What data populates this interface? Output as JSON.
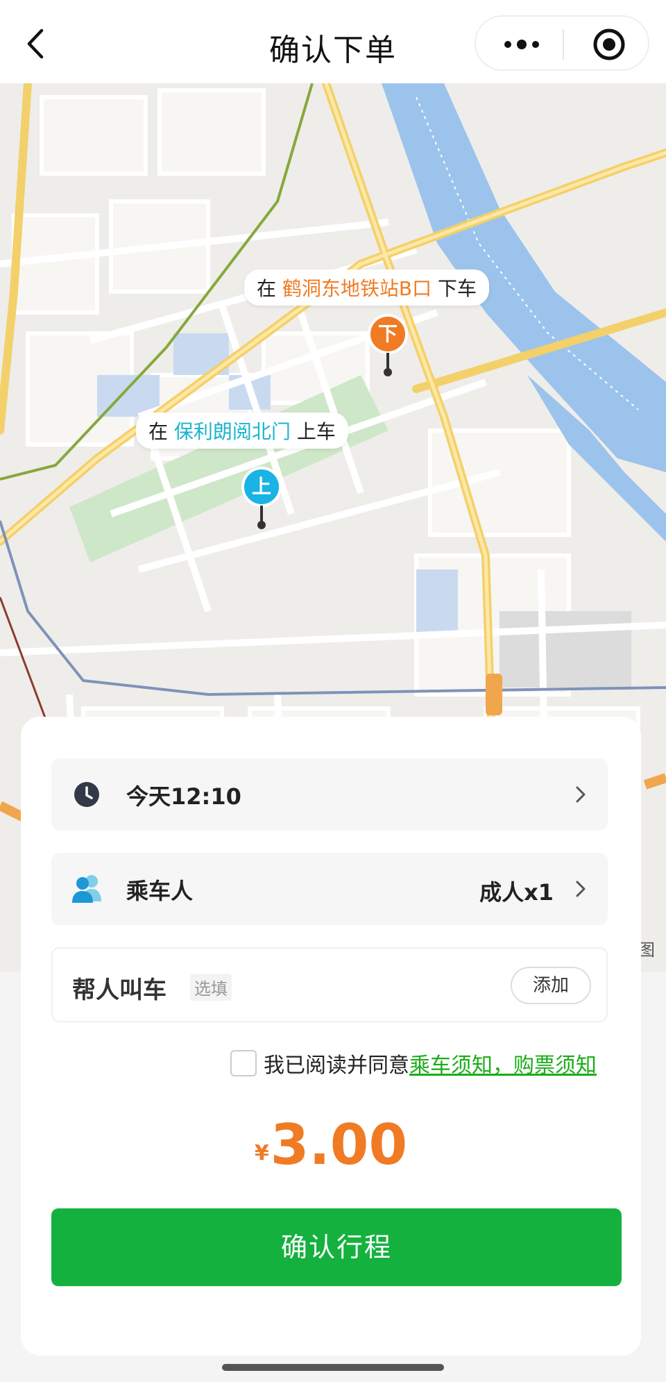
{
  "header": {
    "title": "确认下单",
    "back_icon": "chevron-left-icon",
    "more_icon": "more-dots-icon",
    "close_icon": "target-circle-icon"
  },
  "map": {
    "dropoff": {
      "prefix": "在 ",
      "place": "鹤洞东地铁站B口",
      "suffix": " 下车",
      "pin_text": "下",
      "color": "#f07b24"
    },
    "pickup": {
      "prefix": "在 ",
      "place": "保利朗阅北门",
      "suffix": " 上车",
      "pin_text": "上",
      "color": "#1ab3cf"
    },
    "corner_text": "图"
  },
  "order": {
    "time": {
      "label": "今天12:10",
      "icon": "clock-icon"
    },
    "passenger": {
      "label": "乘车人",
      "value": "成人x1",
      "icon": "people-icon"
    },
    "help": {
      "label": "帮人叫车",
      "optional": "选填",
      "add_label": "添加"
    },
    "agreement": {
      "text": "我已阅读并同意",
      "link": "乘车须知，购票须知",
      "checked": false
    },
    "price": {
      "currency": "¥",
      "amount": "3.00"
    },
    "confirm_label": "确认行程"
  },
  "colors": {
    "accent_green": "#15b13f",
    "price_orange": "#f07b24",
    "link_green": "#1aad19"
  }
}
